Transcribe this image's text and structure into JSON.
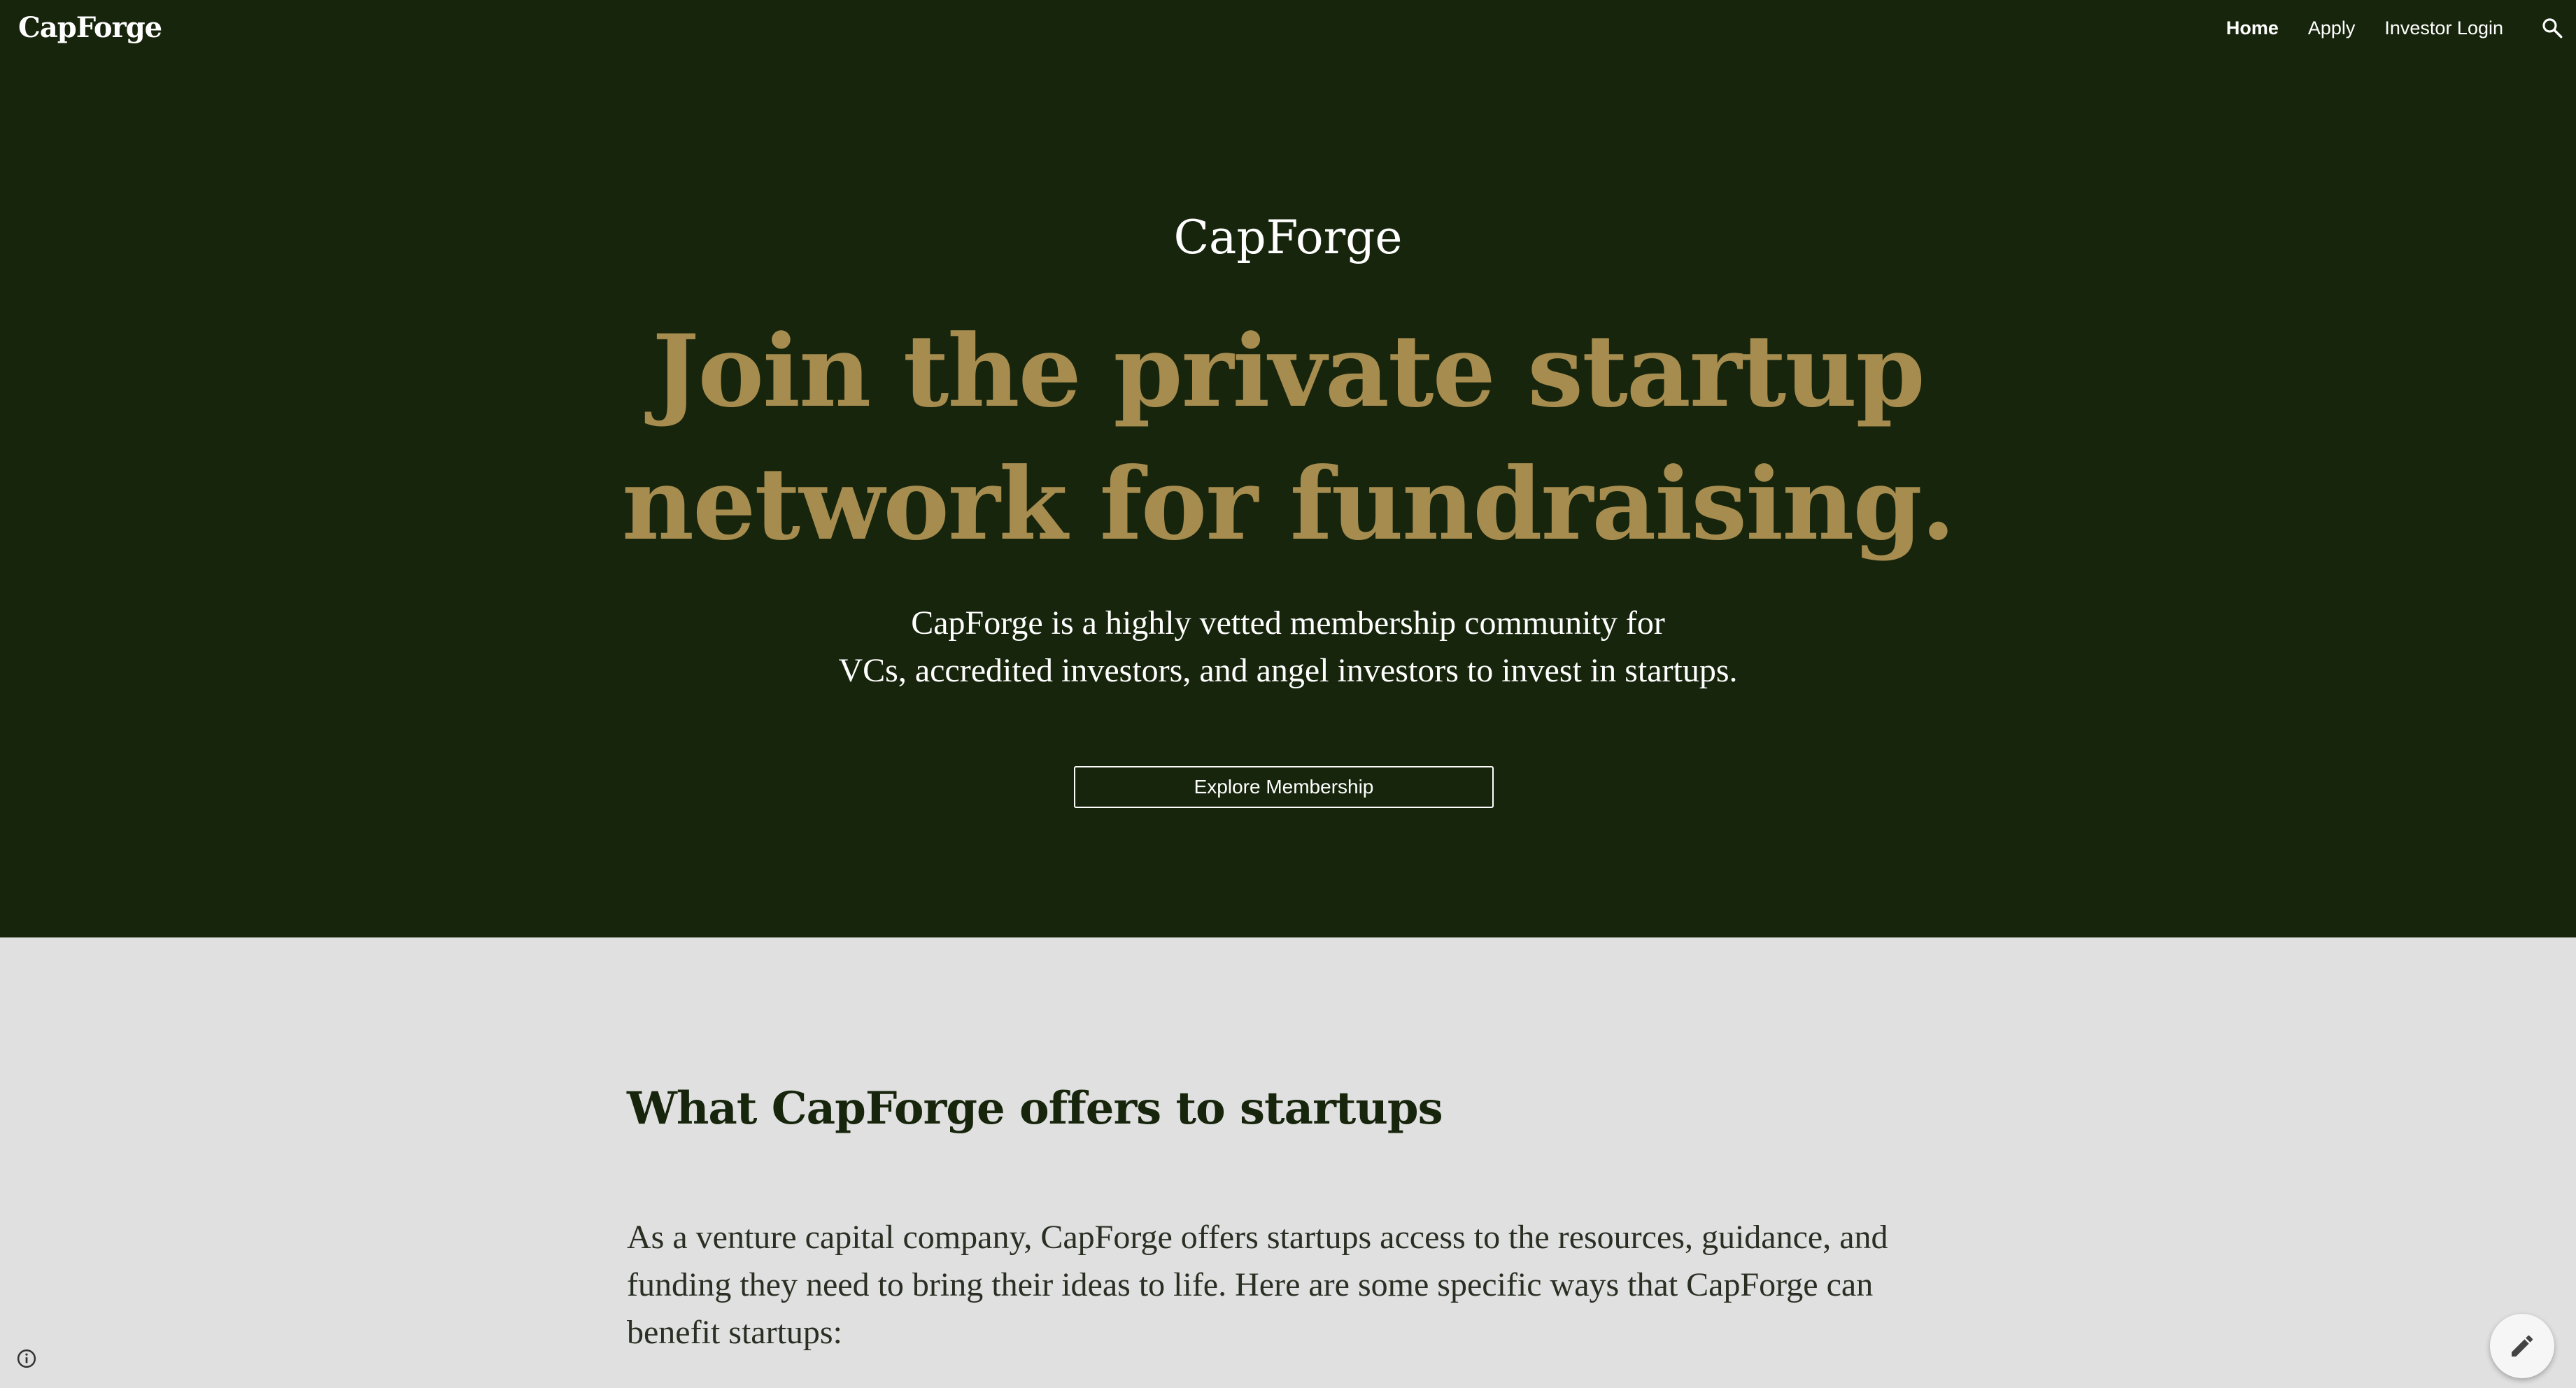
{
  "header": {
    "brand": "CapForge",
    "nav": [
      {
        "label": "Home",
        "active": true
      },
      {
        "label": "Apply",
        "active": false
      },
      {
        "label": "Investor Login",
        "active": false
      }
    ],
    "search_icon": "search-icon"
  },
  "hero": {
    "title": "CapForge",
    "headline_lines": [
      "Join the private startup",
      "network for fundraising."
    ],
    "description_lines": [
      "CapForge is a highly vetted membership community for",
      "VCs, accredited investors, and angel investors to invest in startups."
    ],
    "cta_label": "Explore Membership"
  },
  "section": {
    "title": "What CapForge offers to startups",
    "body_lines": [
      "As a venture capital company, CapForge offers startups access to the resources, guidance, and",
      "funding they need to bring their ideas to life. Here are some specific ways that CapForge can",
      "benefit startups:"
    ]
  },
  "footer": {
    "info_icon": "info-icon",
    "edit_icon": "pencil-icon"
  },
  "colors": {
    "hero_background": "#17250c",
    "headline_gold": "#a68c4f",
    "page_background": "#e0e0e0"
  }
}
